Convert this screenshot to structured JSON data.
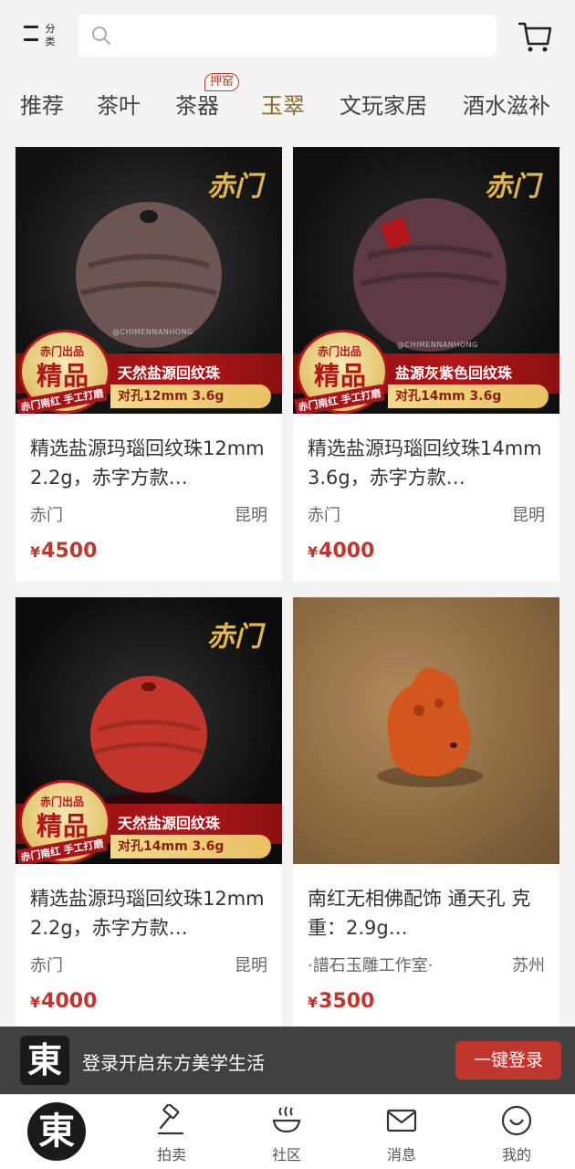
{
  "header": {
    "category_label": "分类",
    "search_placeholder": ""
  },
  "tabs": [
    {
      "label": "推荐",
      "active": false
    },
    {
      "label": "茶叶",
      "active": false
    },
    {
      "label": "茶器",
      "active": false,
      "badge": "押窑"
    },
    {
      "label": "玉翠",
      "active": true
    },
    {
      "label": "文玩家居",
      "active": false
    },
    {
      "label": "酒水滋补",
      "active": false
    }
  ],
  "products": [
    {
      "title": "精选盐源玛瑙回纹珠12mm 2.2g，赤字方款…",
      "shop": "赤门",
      "city": "昆明",
      "currency": "¥",
      "price": "4500",
      "image": {
        "brand_mark": "赤门",
        "watermark": "@CHIMENNANHONG",
        "promo_top": "赤门出品",
        "promo_big": "精品",
        "promo_bottom": "赤门南红 手工打磨",
        "promo_line1": "天然盐源回纹珠",
        "promo_line2": "对孔12mm 3.6g",
        "bead_color": "#6e5552"
      }
    },
    {
      "title": "精选盐源玛瑙回纹珠14mm 3.6g，赤字方款…",
      "shop": "赤门",
      "city": "昆明",
      "currency": "¥",
      "price": "4000",
      "image": {
        "brand_mark": "赤门",
        "watermark": "@CHIMENNANHONG",
        "promo_top": "赤门出品",
        "promo_big": "精品",
        "promo_bottom": "赤门南红 手工打磨",
        "promo_line1": "盐源灰紫色回纹珠",
        "promo_line2": "对孔14mm 3.6g",
        "bead_color": "#5e3a44"
      }
    },
    {
      "title": "精选盐源玛瑙回纹珠12mm 2.2g，赤字方款…",
      "shop": "赤门",
      "city": "昆明",
      "currency": "¥",
      "price": "4000",
      "image": {
        "brand_mark": "赤门",
        "watermark": "",
        "promo_top": "赤门出品",
        "promo_big": "精品",
        "promo_bottom": "赤门南红 手工打磨",
        "promo_line1": "天然盐源回纹珠",
        "promo_line2": "对孔14mm 3.6g",
        "bead_color": "#c3352a"
      }
    },
    {
      "title": "南红无相佛配饰 通天孔 克重：2.9g…",
      "shop": "·譜石玉雕工作室·",
      "city": "苏州",
      "currency": "¥",
      "price": "3500",
      "image": {
        "bead_color": "#d4561f"
      }
    }
  ],
  "login_banner": {
    "logo": "東",
    "text": "登录开启东方美学生活",
    "button": "一键登录"
  },
  "bottom_nav": {
    "home_logo": "東",
    "items": [
      {
        "label": "拍卖",
        "icon": "auction-hammer-icon"
      },
      {
        "label": "社区",
        "icon": "community-icon"
      },
      {
        "label": "消息",
        "icon": "message-envelope-icon"
      },
      {
        "label": "我的",
        "icon": "profile-face-icon"
      }
    ]
  },
  "colors": {
    "accent": "#c0362c",
    "active_tab": "#8b6a2b",
    "background": "#f3f3f3"
  }
}
